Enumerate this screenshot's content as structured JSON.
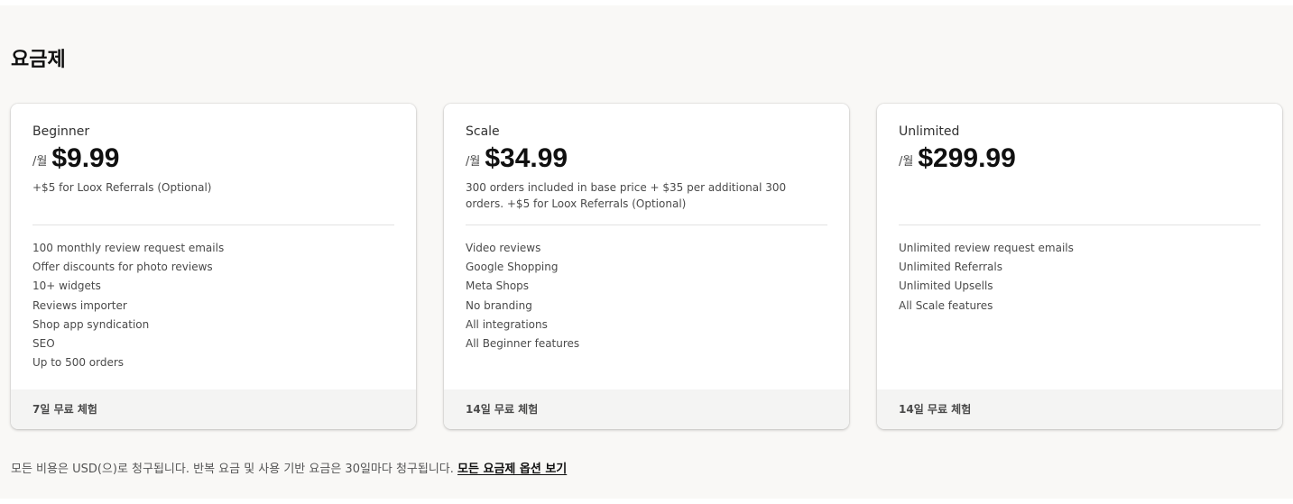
{
  "section": {
    "title": "요금제"
  },
  "plans": [
    {
      "name": "Beginner",
      "price_unit": "/월",
      "price": "$9.99",
      "note": "+$5 for Loox Referrals (Optional)",
      "features": [
        "100 monthly review request emails",
        "Offer discounts for photo reviews",
        "10+ widgets",
        "Reviews importer",
        "Shop app syndication",
        "SEO",
        "Up to 500 orders"
      ],
      "trial": "7일 무료 체험"
    },
    {
      "name": "Scale",
      "price_unit": "/월",
      "price": "$34.99",
      "note": "300 orders included in base price + $35 per additional 300 orders. +$5 for Loox Referrals (Optional)",
      "features": [
        "Video reviews",
        "Google Shopping",
        "Meta Shops",
        "No branding",
        "All integrations",
        "All Beginner features"
      ],
      "trial": "14일 무료 체험"
    },
    {
      "name": "Unlimited",
      "price_unit": "/월",
      "price": "$299.99",
      "note": "",
      "features": [
        "Unlimited review request emails",
        "Unlimited Referrals",
        "Unlimited Upsells",
        "All Scale features"
      ],
      "trial": "14일 무료 체험"
    }
  ],
  "footer": {
    "text": "모든 비용은 USD(으)로 청구됩니다. 반복 요금 및 사용 기반 요금은 30일마다 청구됩니다.",
    "link_label": "모든 요금제 옵션 보기"
  }
}
